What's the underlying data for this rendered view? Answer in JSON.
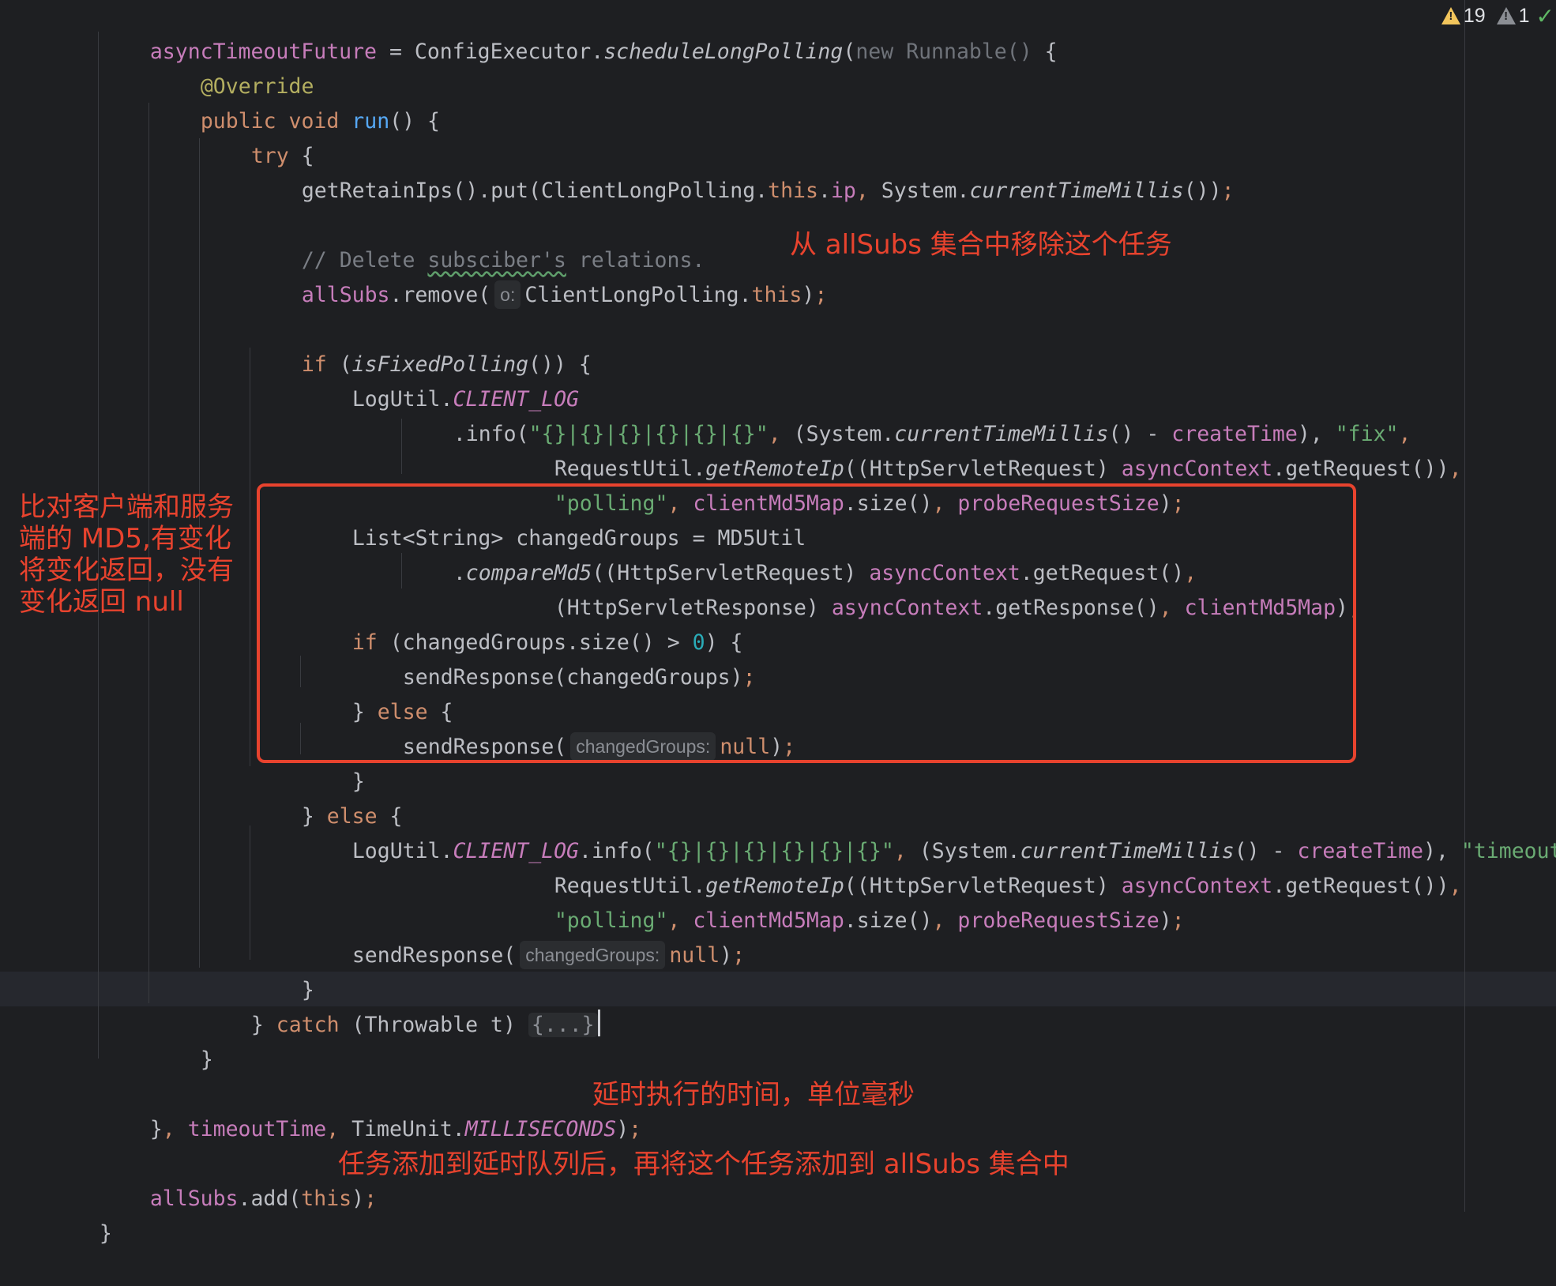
{
  "code": {
    "l01": [
      "asyncTimeoutFuture",
      " = ConfigExecutor.",
      "scheduleLongPolling",
      "(",
      "new Runnable()",
      " {"
    ],
    "l02": [
      "@Override"
    ],
    "l03": [
      "public void ",
      "run",
      "() {"
    ],
    "l04": [
      "try",
      " {"
    ],
    "l05": [
      "getRetainIps().put(ClientLongPolling.",
      "this",
      ".",
      "ip",
      ", ",
      "System.",
      "currentTimeMillis",
      "())",
      ";"
    ],
    "l06": [
      "// Delete ",
      "subsciber's",
      " relations."
    ],
    "l07": [
      "allSubs",
      ".remove(",
      "o:",
      "ClientLongPolling.",
      "this",
      ")",
      ";"
    ],
    "l08": [
      "if",
      " (",
      "isFixedPolling",
      "()) {"
    ],
    "l09": [
      "LogUtil.",
      "CLIENT_LOG"
    ],
    "l10": [
      ".info(",
      "\"{}|{}|{}|{}|{}|{}\"",
      ", ",
      "(System.",
      "currentTimeMillis",
      "() - ",
      "createTime",
      "), ",
      "\"fix\"",
      ","
    ],
    "l11": [
      "RequestUtil.",
      "getRemoteIp",
      "((HttpServletRequest) ",
      "asyncContext",
      ".getRequest())",
      ","
    ],
    "l12": [
      "\"polling\"",
      ", ",
      "clientMd5Map",
      ".size()",
      ", ",
      "probeRequestSize",
      ")",
      ";"
    ],
    "l13": [
      "List<String> changedGroups = MD5Util"
    ],
    "l14": [
      ".",
      "compareMd5",
      "((HttpServletRequest) ",
      "asyncContext",
      ".getRequest()",
      ","
    ],
    "l15": [
      "(HttpServletResponse) ",
      "asyncContext",
      ".getResponse()",
      ", ",
      "clientMd5Map",
      ")",
      ";"
    ],
    "l16": [
      "if",
      " (changedGroups.size() > ",
      "0",
      ") {"
    ],
    "l17": [
      "sendResponse(changedGroups)",
      ";"
    ],
    "l18": [
      "} ",
      "else",
      " {"
    ],
    "l19": [
      "sendResponse(",
      "changedGroups:",
      "null",
      ")",
      ";"
    ],
    "l20": [
      "}"
    ],
    "l21": [
      "} ",
      "else",
      " {"
    ],
    "l22": [
      "LogUtil.",
      "CLIENT_LOG",
      ".info(",
      "\"{}|{}|{}|{}|{}|{}\"",
      ", ",
      "(System.",
      "currentTimeMillis",
      "() - ",
      "createTime",
      "), ",
      "\"timeout\"",
      ","
    ],
    "l23": [
      "RequestUtil.",
      "getRemoteIp",
      "((HttpServletRequest) ",
      "asyncContext",
      ".getRequest())",
      ","
    ],
    "l24": [
      "\"polling\"",
      ", ",
      "clientMd5Map",
      ".size()",
      ", ",
      "probeRequestSize",
      ")",
      ";"
    ],
    "l25": [
      "sendResponse(",
      "changedGroups:",
      "null",
      ")",
      ";"
    ],
    "l26": [
      "}"
    ],
    "l27": [
      "} ",
      "catch",
      " (Throwable t) ",
      "{...}"
    ],
    "l28": [
      "}"
    ],
    "l29": [
      "}",
      ", ",
      "timeoutTime",
      ", ",
      "TimeUnit.",
      "MILLISECONDS",
      ")",
      ";"
    ],
    "l30": [
      "allSubs",
      ".add(",
      "this",
      ")",
      ";"
    ],
    "l31": [
      "}"
    ]
  },
  "annotations": {
    "remove_note": "从 allSubs 集合中移除这个任务",
    "compare_note": "比对客户端和服务\n端的 MD5,有变化\n将变化返回，没有\n变化返回 null",
    "delay_note": "延时执行的时间，单位毫秒",
    "add_note": "任务添加到延时队列后，再将这个任务添加到 allSubs 集合中"
  },
  "status": {
    "warnings": "19",
    "weak_warnings": "1",
    "ok_mark": "✓"
  },
  "colors": {
    "background": "#1e1f22",
    "keyword": "#cf8e6d",
    "string": "#6aab73",
    "field": "#c77dbb",
    "annotation_text": "#e8432e",
    "warning": "#f2c55c"
  }
}
